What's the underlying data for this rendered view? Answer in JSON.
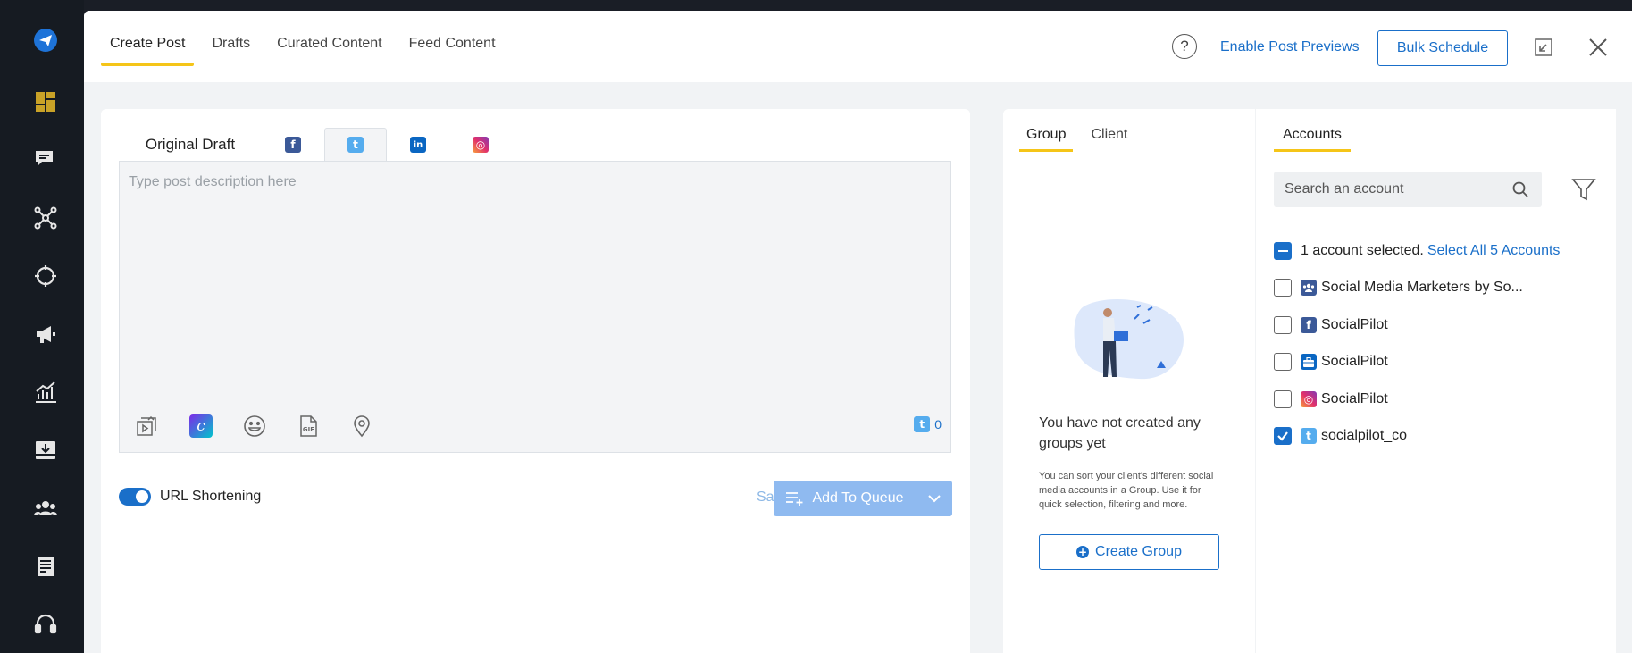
{
  "rail": {
    "icons": [
      "paper-plane-icon",
      "dashboard-icon",
      "chat-icon",
      "network-icon",
      "target-icon",
      "megaphone-icon",
      "analytics-icon",
      "inbox-icon",
      "team-icon",
      "content-icon",
      "support-icon"
    ]
  },
  "header": {
    "tabs": [
      "Create Post",
      "Drafts",
      "Curated Content",
      "Feed Content"
    ],
    "active_tab": "Create Post",
    "help_label": "?",
    "enable_previews": "Enable Post Previews",
    "bulk_schedule": "Bulk Schedule"
  },
  "editor": {
    "original_draft": "Original Draft",
    "network_tabs": [
      {
        "network": "facebook",
        "glyph": "f"
      },
      {
        "network": "twitter",
        "glyph": "t"
      },
      {
        "network": "linkedin",
        "glyph": "in"
      },
      {
        "network": "instagram",
        "glyph": "◎"
      }
    ],
    "selected_network": "twitter",
    "placeholder": "Type post description here",
    "value": "",
    "char_count": "0",
    "gif_label": "GIF",
    "url_shortening_label": "URL Shortening",
    "url_shortening_on": true,
    "save_as_draft": "Save as Draft",
    "add_to_queue": "Add To Queue"
  },
  "group_panel": {
    "tabs": [
      "Group",
      "Client"
    ],
    "active_tab": "Group",
    "empty_title": "You have not created any groups yet",
    "empty_desc": "You can sort your client's different social media accounts in a Group. Use it for quick selection, filtering and more.",
    "create_group": "Create Group"
  },
  "accounts_panel": {
    "tab": "Accounts",
    "search_placeholder": "Search an account",
    "selected_text": "1 account selected.",
    "select_all": "Select All 5 Accounts",
    "accounts": [
      {
        "name": "Social Media Marketers by So...",
        "type": "group",
        "checked": false
      },
      {
        "name": "SocialPilot",
        "type": "facebook",
        "checked": false
      },
      {
        "name": "SocialPilot",
        "type": "business",
        "checked": false
      },
      {
        "name": "SocialPilot",
        "type": "instagram",
        "checked": false
      },
      {
        "name": "socialpilot_co",
        "type": "twitter",
        "checked": true
      }
    ]
  },
  "colors": {
    "accent": "#1a6fc9",
    "tab_underline": "#f5c518",
    "rail_bg": "#161b22"
  }
}
